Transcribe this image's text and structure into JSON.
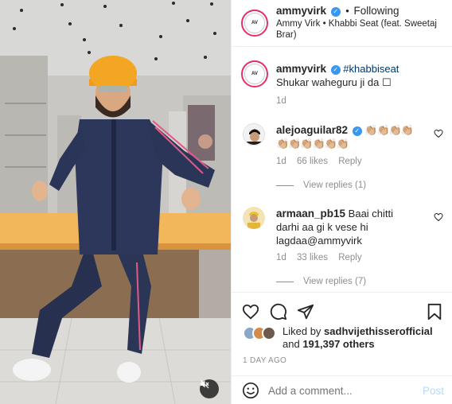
{
  "post": {
    "header": {
      "username": "ammyvirk",
      "verified": true,
      "separator": "•",
      "follow_status": "Following",
      "audio_line": "Ammy Virk • Khabbi Seat (feat. Sweetaj Brar)"
    },
    "caption": {
      "username": "ammyvirk",
      "hashtag": "#khabbiseat",
      "text": "Shukar waheguru ji da ☐",
      "time": "1d"
    },
    "comments": [
      {
        "username": "alejoaguilar82",
        "verified": true,
        "text": "👏🏼👏🏼👏🏼👏🏼👏🏼👏🏼👏🏼👏🏼👏🏼👏🏼",
        "time": "1d",
        "likes": "66 likes",
        "reply": "Reply",
        "view_replies": "View replies (1)"
      },
      {
        "username": "armaan_pb15",
        "verified": false,
        "text": "Baai chitti darhi aa gi k vese hi lagdaa@ammyvirk",
        "time": "1d",
        "likes": "33 likes",
        "reply": "Reply",
        "view_replies": "View replies (7)"
      }
    ],
    "liked_by": {
      "prefix": "Liked by",
      "user": "sadhvijethisserofficial",
      "suffix": "and",
      "count": "191,397 others"
    },
    "date": "1 DAY AGO",
    "add_comment": {
      "placeholder": "Add a comment...",
      "post_label": "Post"
    },
    "colors": {
      "verified": "#3897f0",
      "post_button": "#b3dbff",
      "border": "#efefef"
    },
    "icons": [
      "heart-icon",
      "comment-icon",
      "share-icon",
      "bookmark-icon",
      "emoji-icon",
      "mute-icon"
    ]
  }
}
